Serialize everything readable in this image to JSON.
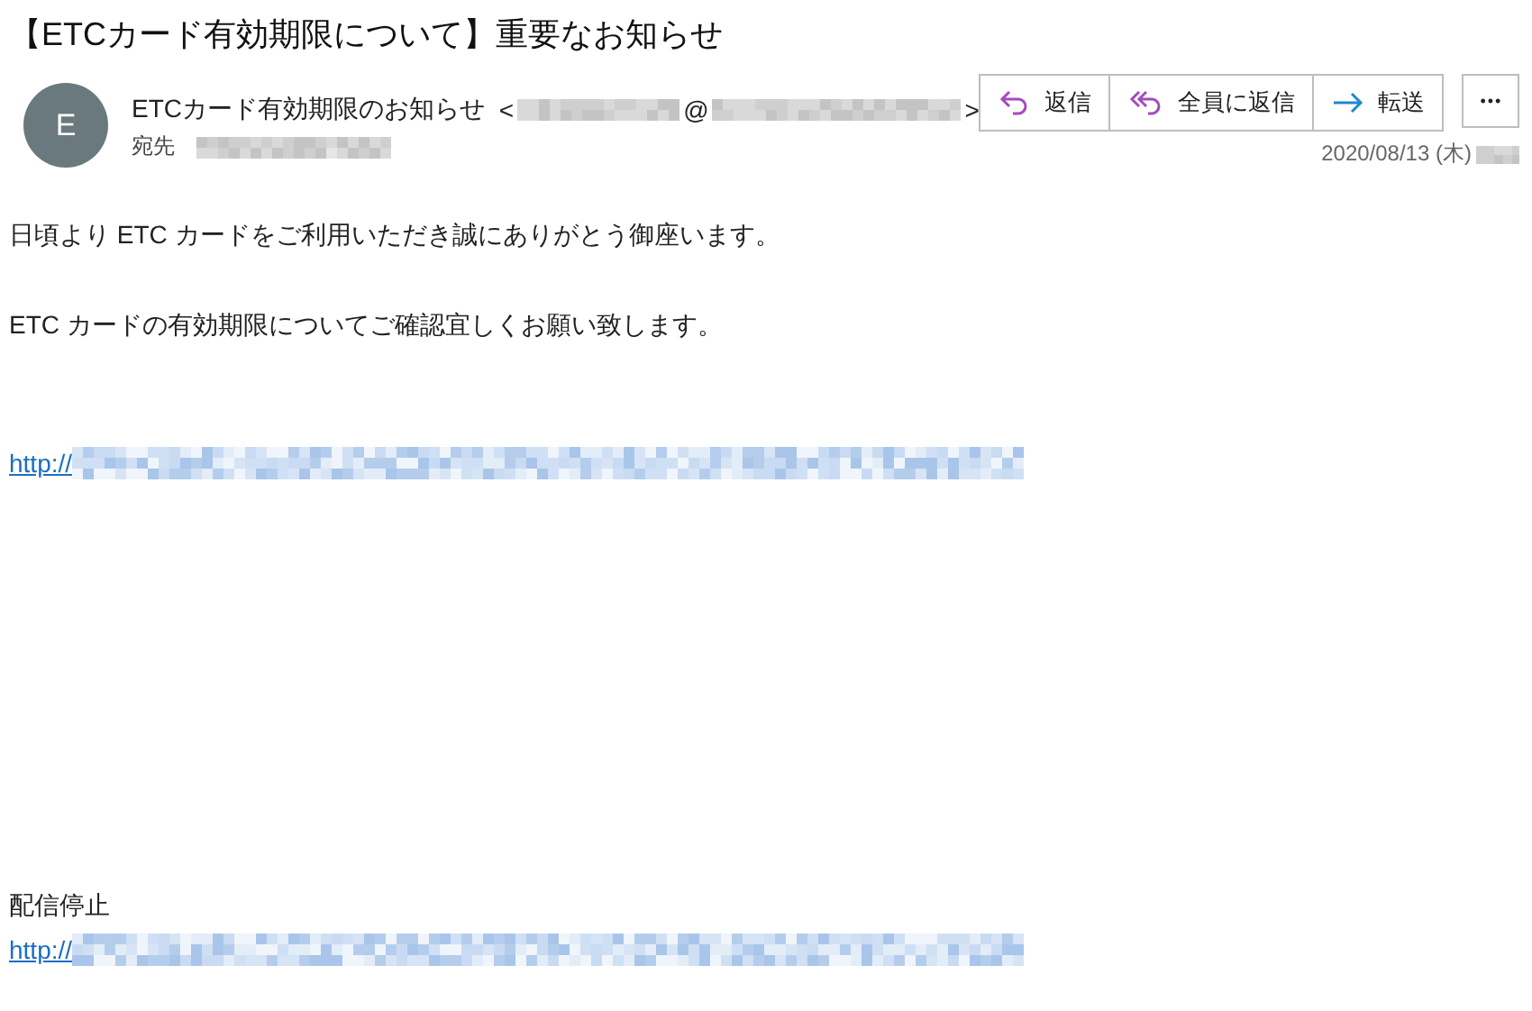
{
  "subject": "【ETCカード有効期限について】重要なお知らせ",
  "sender": {
    "avatar_letter": "E",
    "name": "ETCカード有効期限のお知らせ",
    "open_bracket": "<",
    "at": "@",
    "close_bracket": ">",
    "to_label": "宛先"
  },
  "actions": [
    {
      "kind": "reply",
      "label": "返信"
    },
    {
      "kind": "reply_all",
      "label": "全員に返信"
    },
    {
      "kind": "forward",
      "label": "転送"
    }
  ],
  "more": "•••",
  "date": "2020/08/13 (木)",
  "body": {
    "greeting": "日頃より ETC カードをご利用いただき誠にありがとう御座います。",
    "request": "ETC カードの有効期限についてご確認宜しくお願い致します。",
    "link_prefix": "http://",
    "unsubscribe": "配信停止",
    "unsubscribe_link_prefix": "http://"
  }
}
